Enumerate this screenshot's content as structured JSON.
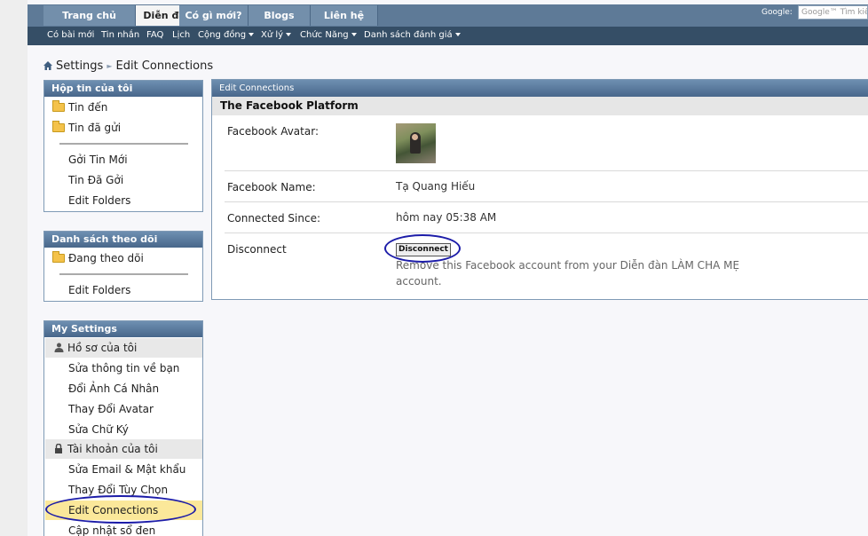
{
  "nav": {
    "tabs": [
      "Trang chủ",
      "Diễn đàn",
      "Có gì mới?",
      "Blogs",
      "Liên hệ"
    ],
    "active_tab": "Diễn đàn",
    "google_label": "Google:",
    "google_placeholder": "Google™ Tìm kiếm"
  },
  "subnav": {
    "links": [
      "Có bài mới",
      "Tin nhắn",
      "FAQ",
      "Lịch",
      "Cộng đồng",
      "Xử lý",
      "Chức Năng",
      "Danh sách đánh giá"
    ]
  },
  "breadcrumb": {
    "root": "Settings",
    "current": "Edit Connections"
  },
  "sidebar": {
    "inbox": {
      "title": "Hộp tin của tôi",
      "folders": [
        "Tin đến",
        "Tin đã gửi"
      ],
      "links": [
        "Gởi Tin Mới",
        "Tin Đã Gởi",
        "Edit Folders"
      ]
    },
    "watch": {
      "title": "Danh sách theo dõi",
      "folders": [
        "Đang theo dõi"
      ],
      "links": [
        "Edit Folders"
      ]
    },
    "settings": {
      "title": "My Settings",
      "profile_section": "Hồ sơ của tôi",
      "profile_links": [
        "Sửa thông tin về bạn",
        "Đổi Ảnh Cá Nhân",
        "Thay Đổi Avatar",
        "Sửa Chữ Ký"
      ],
      "account_section": "Tài khoản của tôi",
      "account_links": [
        "Sửa Email & Mật khẩu",
        "Thay Đổi Tùy Chọn",
        "Edit Connections",
        "Cập nhật sổ đen"
      ]
    }
  },
  "main": {
    "panel_title": "Edit Connections",
    "platform_title": "The Facebook Platform",
    "avatar_label": "Facebook Avatar:",
    "name_label": "Facebook Name:",
    "name_value": "Tạ Quang Hiếu",
    "since_label": "Connected Since:",
    "since_value": "hôm nay 05:38 AM",
    "disconnect_label": "Disconnect",
    "disconnect_button": "Disconnect",
    "disconnect_desc": "Remove this Facebook account from your Diễn đàn LÀM CHA MẸ account."
  },
  "colors": {
    "nav_bar": "#5e7a97",
    "sub_bar": "#354e66",
    "box_header": "#5a7a9e",
    "highlight": "#fbe89a",
    "annotation_ellipse": "#1c1ca8"
  }
}
